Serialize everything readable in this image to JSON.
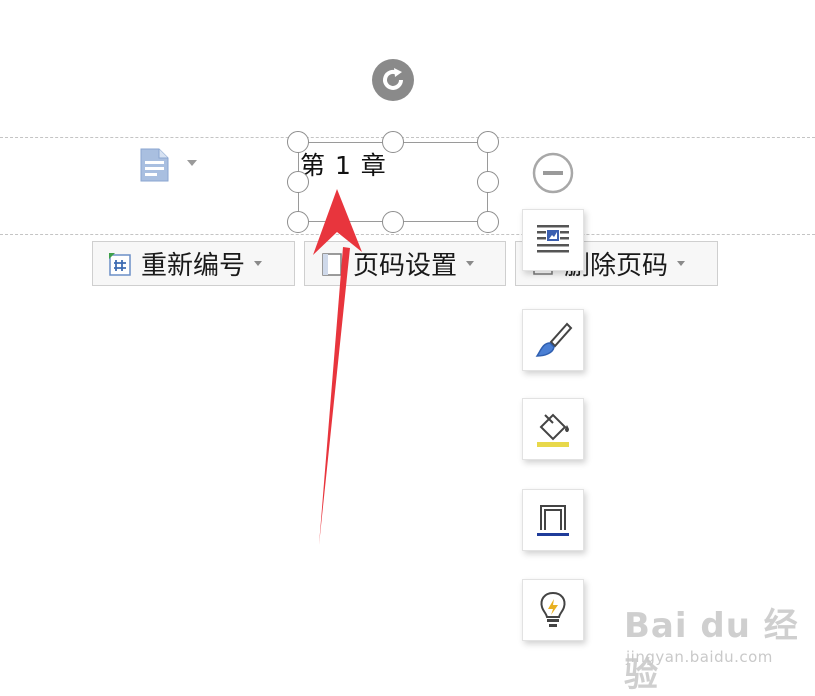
{
  "header_section": {
    "textbox_text": "第 1 章"
  },
  "toolbar": {
    "renumber_label": "重新编号",
    "page_number_settings_label": "页码设置",
    "delete_page_number_label": "删除页码"
  },
  "side_toolbar": {
    "items": [
      {
        "icon": "text-wrap-icon"
      },
      {
        "icon": "brush-icon"
      },
      {
        "icon": "fill-bucket-icon"
      },
      {
        "icon": "border-outline-icon"
      },
      {
        "icon": "lightbulb-icon"
      }
    ]
  },
  "watermark": {
    "brand": "Bai du 经验",
    "url": "jingyan.baidu.com"
  },
  "colors": {
    "arrow": "#e8353d",
    "handle_border": "#8e8e8e",
    "rotate_handle": "#8a8a8a",
    "fill_accent": "#e8d84a",
    "border_accent": "#1f3c9a",
    "doc_icon": "#9bb3d6"
  }
}
